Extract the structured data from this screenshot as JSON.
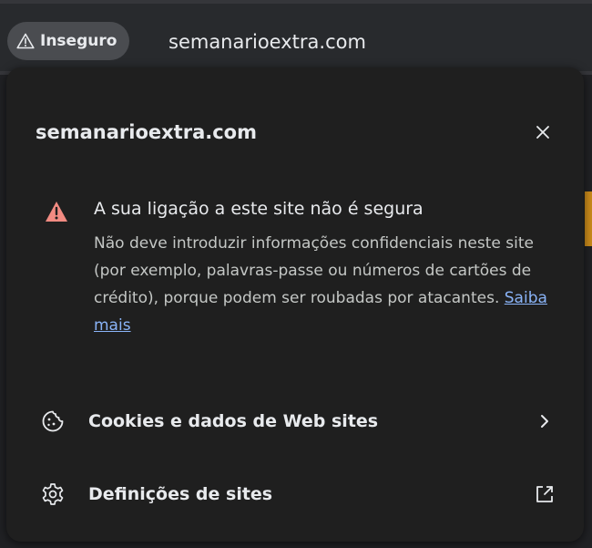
{
  "address_bar": {
    "security_chip_label": "Inseguro",
    "url": "semanarioextra.com"
  },
  "popup": {
    "title": "semanarioextra.com",
    "warning": {
      "title": "A sua ligação a este site não é segura",
      "body": "Não deve introduzir informações confidenciais neste site (por exemplo, palavras-passe ou números de cartões de crédito), porque podem ser roubadas por atacantes.",
      "link_text": "Saiba mais"
    },
    "rows": [
      {
        "label": "Cookies e dados de Web sites",
        "icon": "cookie-icon",
        "trail_icon": "chevron-right-icon"
      },
      {
        "label": "Definições de sites",
        "icon": "gear-icon",
        "trail_icon": "external-link-icon"
      }
    ]
  },
  "colors": {
    "warning_red": "#f28b82",
    "link_blue": "#8ab4f8",
    "popup_bg": "#1f1f1f"
  }
}
